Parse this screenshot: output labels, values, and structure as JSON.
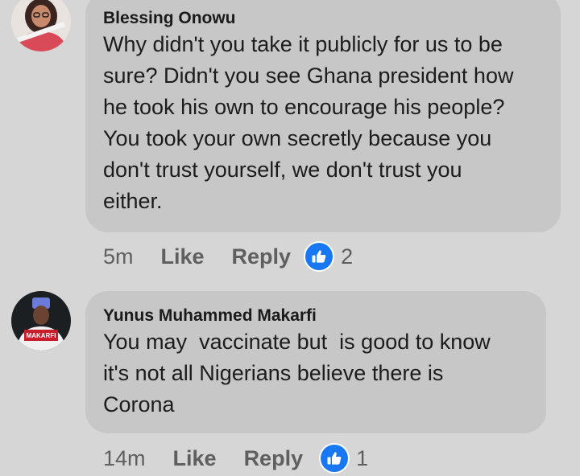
{
  "comments": [
    {
      "author": "Blessing Onowu",
      "lines": [
        "Why didn't you take it publicly for us to be",
        "sure? Didn't you see Ghana president how",
        "he took his own to encourage his people?",
        "You took your own secretly because you",
        "don't trust yourself, we don't trust you",
        "either."
      ],
      "time": "5m",
      "like_label": "Like",
      "reply_label": "Reply",
      "reaction_icon": "thumbs-up-icon",
      "reaction_count": "2"
    },
    {
      "author": "Yunus Muhammed Makarfi",
      "lines": [
        "You may  vaccinate but  is good to know",
        "it's not all Nigerians believe there is",
        "Corona"
      ],
      "time": "14m",
      "like_label": "Like",
      "reply_label": "Reply",
      "reaction_icon": "thumbs-up-icon",
      "reaction_count": "1",
      "avatar_text": "MAKARFI"
    }
  ],
  "colors": {
    "background": "#d6d6d6",
    "bubble": "#c7c7c7",
    "reaction_blue": "#1877f2",
    "meta_text": "#5f5f5f"
  }
}
